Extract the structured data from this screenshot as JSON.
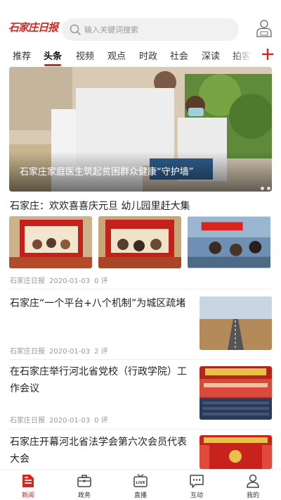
{
  "header": {
    "logo_text": "石家庄日报",
    "search_placeholder": "输入关键词搜索",
    "login_icon": "user-login-icon"
  },
  "tabs": [
    {
      "label": "推荐"
    },
    {
      "label": "头条",
      "active": true
    },
    {
      "label": "视频"
    },
    {
      "label": "观点"
    },
    {
      "label": "时政"
    },
    {
      "label": "社会"
    },
    {
      "label": "深读"
    },
    {
      "label": "拍客"
    }
  ],
  "accent_color": "#d9251c",
  "hero": {
    "caption": "石家庄家庭医生筑起贫困群众健康“守护墙”"
  },
  "articles": [
    {
      "title": "石家庄：欢欢喜喜庆元旦 幼儿园里赶大集",
      "source": "石家庄日报",
      "date": "2020-01-03",
      "comments": "0 评"
    },
    {
      "title": "石家庄“一个平台+八个机制”为城区疏堵",
      "source": "石家庄日报",
      "date": "2020-01-03",
      "comments": "2 评"
    },
    {
      "title": "在石家庄举行河北省党校（行政学院）工作会议",
      "source": "石家庄日报",
      "date": "2020-01-03",
      "comments": "0 评"
    },
    {
      "title": "石家庄开幕河北省法学会第六次会员代表大会"
    }
  ],
  "bottom_nav": [
    {
      "label": "新闻",
      "icon": "news-icon",
      "active": true
    },
    {
      "label": "政务",
      "icon": "briefcase-icon"
    },
    {
      "label": "直播",
      "icon": "live-tv-icon"
    },
    {
      "label": "互动",
      "icon": "chat-icon"
    },
    {
      "label": "我的",
      "icon": "profile-icon"
    }
  ]
}
